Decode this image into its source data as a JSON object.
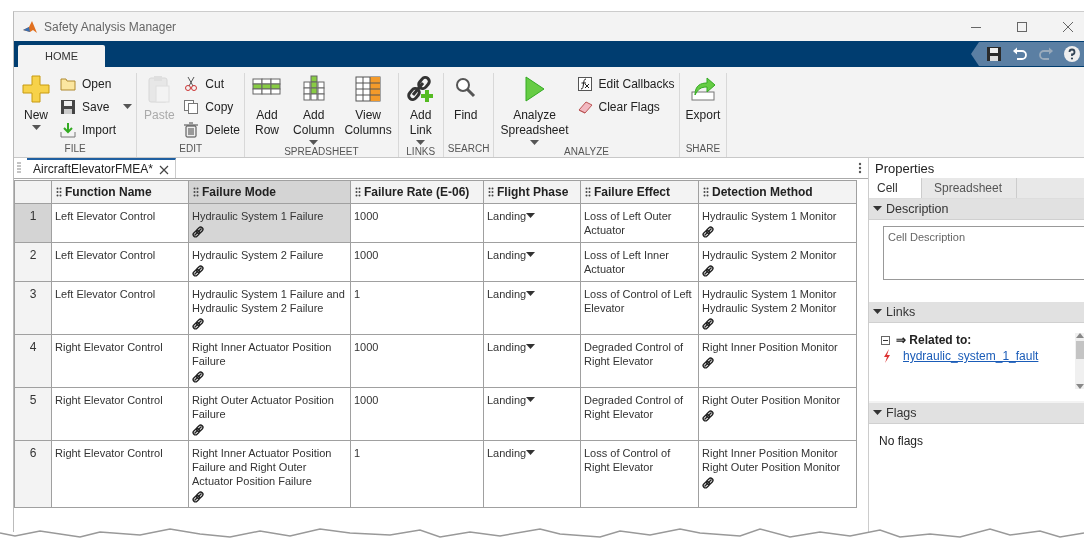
{
  "window": {
    "title": "Safety Analysis Manager"
  },
  "ribbon": {
    "tabs": [
      {
        "label": "HOME",
        "selected": true
      }
    ],
    "groups": [
      {
        "label": "FILE",
        "items": [
          {
            "kind": "large",
            "label": "New",
            "menu": true,
            "disabled": false
          },
          {
            "kind": "stack",
            "items": [
              {
                "label": "Open",
                "menu": false,
                "disabled": false
              },
              {
                "label": "Save",
                "menu": true,
                "disabled": false
              },
              {
                "label": "Import",
                "menu": false,
                "disabled": false
              }
            ]
          }
        ]
      },
      {
        "label": "EDIT",
        "items": [
          {
            "kind": "large",
            "label": "Paste",
            "menu": false,
            "disabled": true
          },
          {
            "kind": "stack",
            "items": [
              {
                "label": "Cut",
                "menu": false,
                "disabled": false
              },
              {
                "label": "Copy",
                "menu": false,
                "disabled": false
              },
              {
                "label": "Delete",
                "menu": false,
                "disabled": false
              }
            ]
          }
        ]
      },
      {
        "label": "SPREADSHEET",
        "items": [
          {
            "kind": "large",
            "label": "Add\nRow",
            "menu": false,
            "disabled": false
          },
          {
            "kind": "large",
            "label": "Add\nColumn",
            "menu": true,
            "disabled": false
          },
          {
            "kind": "large",
            "label": "View\nColumns",
            "menu": false,
            "disabled": false
          }
        ]
      },
      {
        "label": "LINKS",
        "items": [
          {
            "kind": "large",
            "label": "Add\nLink",
            "menu": true,
            "disabled": false
          }
        ]
      },
      {
        "label": "SEARCH",
        "items": [
          {
            "kind": "large",
            "label": "Find",
            "menu": false,
            "disabled": false
          }
        ]
      },
      {
        "label": "ANALYZE",
        "items": [
          {
            "kind": "large",
            "label": "Analyze\nSpreadsheet",
            "menu": true,
            "disabled": false
          },
          {
            "kind": "stack",
            "items": [
              {
                "label": "Edit Callbacks",
                "menu": false,
                "disabled": false
              },
              {
                "label": "Clear Flags",
                "menu": false,
                "disabled": false
              }
            ]
          }
        ]
      },
      {
        "label": "SHARE",
        "items": [
          {
            "kind": "large",
            "label": "Export",
            "menu": false,
            "disabled": false
          }
        ]
      }
    ]
  },
  "document_tabs": [
    {
      "label": "AircraftElevatorFMEA*",
      "selected": true
    }
  ],
  "table": {
    "columns": [
      "Function Name",
      "Failure Mode",
      "Failure Rate (E-06)",
      "Flight Phase",
      "Failure Effect",
      "Detection Method"
    ],
    "rows": [
      {
        "number": "1",
        "selected": true,
        "cells": [
          {
            "kind": "text",
            "lines": [
              "Left Elevator Control"
            ],
            "linked": false,
            "selected": false
          },
          {
            "kind": "text",
            "lines": [
              "Hydraulic System 1 Failure"
            ],
            "linked": true,
            "selected": true
          },
          {
            "kind": "text",
            "lines": [
              "1000"
            ],
            "linked": false,
            "selected": false
          },
          {
            "kind": "dropdown",
            "lines": [
              "Landing"
            ],
            "linked": false,
            "selected": false
          },
          {
            "kind": "text",
            "lines": [
              "Loss of Left Outer Actuator"
            ],
            "linked": false,
            "selected": false
          },
          {
            "kind": "text",
            "lines": [
              "Hydraulic System 1 Monitor"
            ],
            "linked": true,
            "selected": false
          }
        ]
      },
      {
        "number": "2",
        "selected": false,
        "cells": [
          {
            "kind": "text",
            "lines": [
              "Left Elevator Control"
            ],
            "linked": false,
            "selected": false
          },
          {
            "kind": "text",
            "lines": [
              "Hydraulic System 2 Failure"
            ],
            "linked": true,
            "selected": false
          },
          {
            "kind": "text",
            "lines": [
              "1000"
            ],
            "linked": false,
            "selected": false
          },
          {
            "kind": "dropdown",
            "lines": [
              "Landing"
            ],
            "linked": false,
            "selected": false
          },
          {
            "kind": "text",
            "lines": [
              "Loss of Left Inner Actuator"
            ],
            "linked": false,
            "selected": false
          },
          {
            "kind": "text",
            "lines": [
              "Hydraulic System 2 Monitor"
            ],
            "linked": true,
            "selected": false
          }
        ]
      },
      {
        "number": "3",
        "selected": false,
        "cells": [
          {
            "kind": "text",
            "lines": [
              "Left Elevator Control"
            ],
            "linked": false,
            "selected": false
          },
          {
            "kind": "text",
            "lines": [
              "Hydraulic System 1 Failure and Hydraulic System 2 Failure"
            ],
            "linked": true,
            "selected": false
          },
          {
            "kind": "text",
            "lines": [
              "1"
            ],
            "linked": false,
            "selected": false
          },
          {
            "kind": "dropdown",
            "lines": [
              "Landing"
            ],
            "linked": false,
            "selected": false
          },
          {
            "kind": "text",
            "lines": [
              "Loss of Control of Left Elevator"
            ],
            "linked": false,
            "selected": false
          },
          {
            "kind": "text",
            "lines": [
              "Hydraulic System 1 Monitor",
              "Hydraulic System 2 Monitor"
            ],
            "linked": true,
            "selected": false
          }
        ]
      },
      {
        "number": "4",
        "selected": false,
        "cells": [
          {
            "kind": "text",
            "lines": [
              "Right Elevator Control"
            ],
            "linked": false,
            "selected": false
          },
          {
            "kind": "text",
            "lines": [
              "Right Inner Actuator Position Failure"
            ],
            "linked": true,
            "selected": false
          },
          {
            "kind": "text",
            "lines": [
              "1000"
            ],
            "linked": false,
            "selected": false
          },
          {
            "kind": "dropdown",
            "lines": [
              "Landing"
            ],
            "linked": false,
            "selected": false
          },
          {
            "kind": "text",
            "lines": [
              "Degraded Control of Right Elevator"
            ],
            "linked": false,
            "selected": false
          },
          {
            "kind": "text",
            "lines": [
              "Right Inner Position Monitor"
            ],
            "linked": true,
            "selected": false
          }
        ]
      },
      {
        "number": "5",
        "selected": false,
        "cells": [
          {
            "kind": "text",
            "lines": [
              "Right Elevator Control"
            ],
            "linked": false,
            "selected": false
          },
          {
            "kind": "text",
            "lines": [
              "Right Outer Actuator Position Failure"
            ],
            "linked": true,
            "selected": false
          },
          {
            "kind": "text",
            "lines": [
              "1000"
            ],
            "linked": false,
            "selected": false
          },
          {
            "kind": "dropdown",
            "lines": [
              "Landing"
            ],
            "linked": false,
            "selected": false
          },
          {
            "kind": "text",
            "lines": [
              "Degraded Control of Right Elevator"
            ],
            "linked": false,
            "selected": false
          },
          {
            "kind": "text",
            "lines": [
              "Right Outer Position Monitor"
            ],
            "linked": true,
            "selected": false
          }
        ]
      },
      {
        "number": "6",
        "selected": false,
        "cells": [
          {
            "kind": "text",
            "lines": [
              "Right Elevator Control"
            ],
            "linked": false,
            "selected": false
          },
          {
            "kind": "text",
            "lines": [
              "Right Inner Actuator Position Failure and Right Outer Actuator Position Failure"
            ],
            "linked": true,
            "selected": false
          },
          {
            "kind": "text",
            "lines": [
              "1"
            ],
            "linked": false,
            "selected": false
          },
          {
            "kind": "dropdown",
            "lines": [
              "Landing"
            ],
            "linked": false,
            "selected": false
          },
          {
            "kind": "text",
            "lines": [
              "Loss of Control of Right Elevator"
            ],
            "linked": false,
            "selected": false
          },
          {
            "kind": "text",
            "lines": [
              "Right Inner Position Monitor",
              "Right Outer Position Monitor"
            ],
            "linked": true,
            "selected": false
          }
        ]
      }
    ]
  },
  "properties": {
    "title": "Properties",
    "tabs": [
      {
        "label": "Cell",
        "selected": true
      },
      {
        "label": "Spreadsheet",
        "selected": false
      }
    ],
    "sections": [
      {
        "kind": "description",
        "title": "Description",
        "expanded": true,
        "placeholder": "Cell Description"
      },
      {
        "kind": "links",
        "title": "Links",
        "expanded": true,
        "group": {
          "label": "⇒ Related to:",
          "expanded": true,
          "links": [
            "hydraulic_system_1_fault"
          ]
        }
      },
      {
        "kind": "flags",
        "title": "Flags",
        "expanded": true,
        "text": "No flags"
      }
    ]
  }
}
